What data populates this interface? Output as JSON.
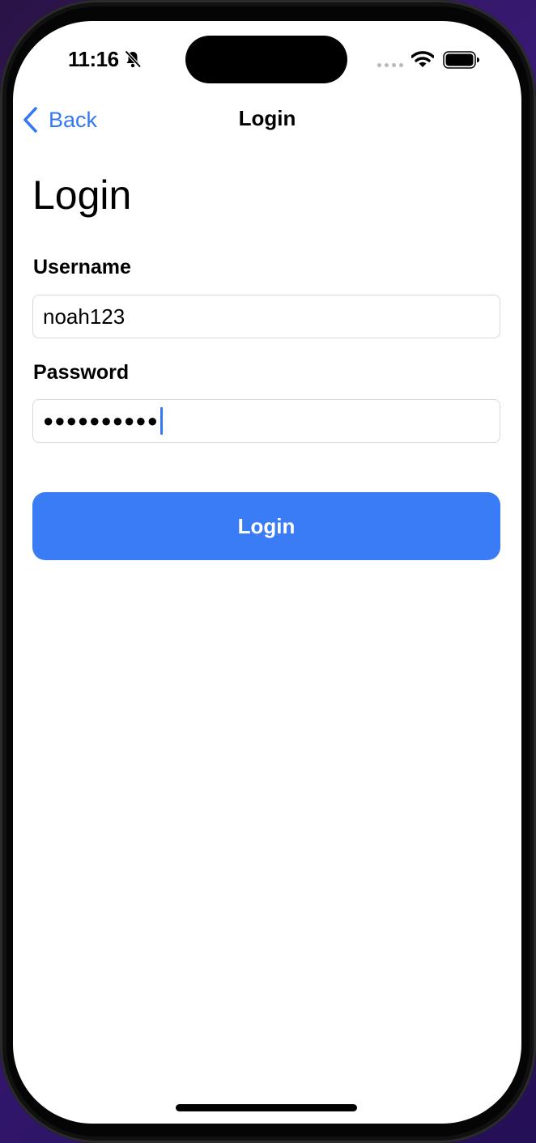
{
  "status_bar": {
    "time": "11:16",
    "icons": [
      "bell-slash-icon",
      "signal-icon",
      "wifi-icon",
      "battery-icon"
    ]
  },
  "nav": {
    "back_label": "Back",
    "title": "Login"
  },
  "form": {
    "heading": "Login",
    "username_label": "Username",
    "username_value": "noah123",
    "password_label": "Password",
    "password_value": "●●●●●●●●●●",
    "submit_label": "Login"
  },
  "colors": {
    "accent": "#3478f6",
    "button": "#3a7bf6",
    "background": "#ffffff",
    "text": "#000000"
  }
}
